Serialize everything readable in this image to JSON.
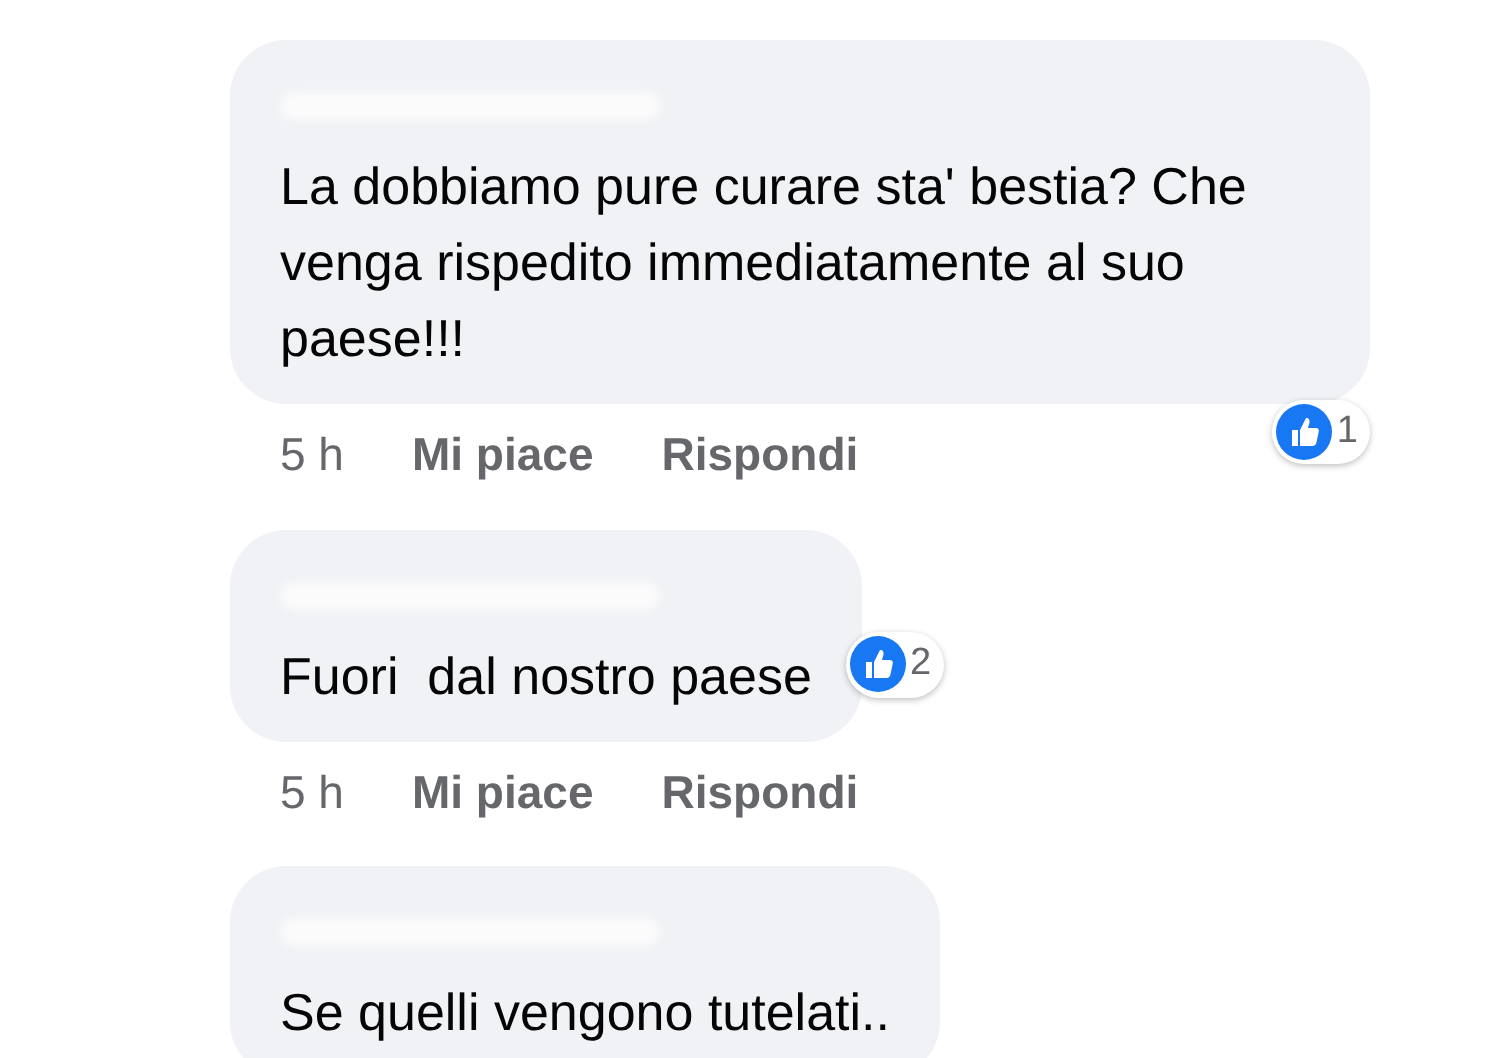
{
  "comments": [
    {
      "text": "La dobbiamo pure curare sta' bestia? Che venga rispedito immediatamente al suo paese!!!",
      "time": "5 h",
      "like": "Mi piace",
      "reply": "Rispondi",
      "reactions": {
        "kind": "corner",
        "count": "1"
      }
    },
    {
      "text": "Fuori  dal nostro paese",
      "time": "5 h",
      "like": "Mi piace",
      "reply": "Rispondi",
      "reactions": {
        "kind": "beside",
        "count": "2"
      }
    },
    {
      "text": "Se quelli vengono tutelati.."
    }
  ]
}
